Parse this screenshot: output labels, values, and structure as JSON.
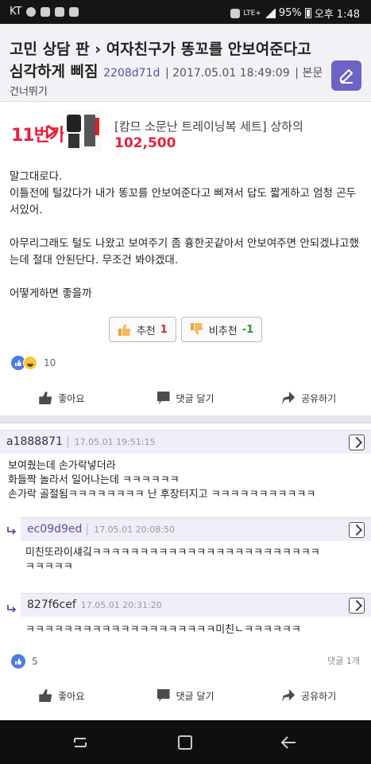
{
  "status_bar": {
    "carrier": "KT",
    "network": "LTE+",
    "battery": "95%",
    "time": "오후 1:48"
  },
  "post": {
    "title": "고민 상담 판 › 여자친구가 똥꼬를 안보여준다고 심각하게 삐짐",
    "board": "고민 상담 판",
    "title_main": "여자친구가 똥꼬를 안보여준다고 심각하게 삐짐",
    "author_id": "2208d71d",
    "datetime": "2017.05.01 18:49:09",
    "body_link": "본문",
    "skip_label": "건너뛰기",
    "paragraphs": [
      "말그대로다.\n이틀전에 털갔다가 내가 똥꼬를 안보여준다고 삐져서 답도 짧게하고 엄청 곤두서있어.",
      "아무리그래도 털도 나왔고 보여주기 좀 흉한곳같아서 안보여주면 안되겠냐고했는데 절대 안된단다. 무조건 봐야겠대.",
      "어떻게하면 좋을까"
    ],
    "upvote_label": "추천",
    "upvote_count": "1",
    "downvote_label": "비추천",
    "downvote_count": "-1",
    "reaction_count": "10"
  },
  "ad": {
    "brand": "11번가",
    "text": "[캄므 소문난 트레이닝복 세트] 상하의",
    "price": "102,500"
  },
  "actions": {
    "like": "좋아요",
    "comment": "댓글 달기",
    "share": "공유하기"
  },
  "comments": [
    {
      "id": "a1888871",
      "time": "17.05.01 19:51:15",
      "text": "보여줬는데 손가락넣더라\n화들짝 놀라서 일어나는데 ㅋㅋㅋㅋㅋㅋ\n손가락 골절됨ㅋㅋㅋㅋㅋㅋㅋㅋ 난 후장터지고 ㅋㅋㅋㅋㅋㅋㅋㅋㅋㅋㅋ",
      "reply": false
    },
    {
      "id": "ec09d9ed",
      "time": "17.05.01 20:08:50",
      "text": "미친또라이섀깈ㅋㅋㅋㅋㅋㅋㅋㅋㅋㅋㅋㅋㅋㅋㅋㅋㅋㅋㅋㅋㅋㅋㅋㅋ\nㅋㅋㅋㅋㅋ",
      "reply": true
    },
    {
      "id": "827f6cef",
      "time": "17.05.01 20:31:20",
      "text": "ㅋㅋㅋㅋㅋㅋㅋㅋㅋㅋㅋㅋㅋㅋㅋㅋㅋㅋㅋㅋ미친ㄴㅋㅋㅋㅋㅋㅋ",
      "reply": true
    }
  ],
  "comment_footer": {
    "reaction_count": "5",
    "comment_count": "댓글 1개"
  },
  "colors": {
    "accent": "#6c64c4",
    "header_bg": "#f2f2f6",
    "ad_red": "#e8213a",
    "like_blue": "#4a7be6"
  }
}
